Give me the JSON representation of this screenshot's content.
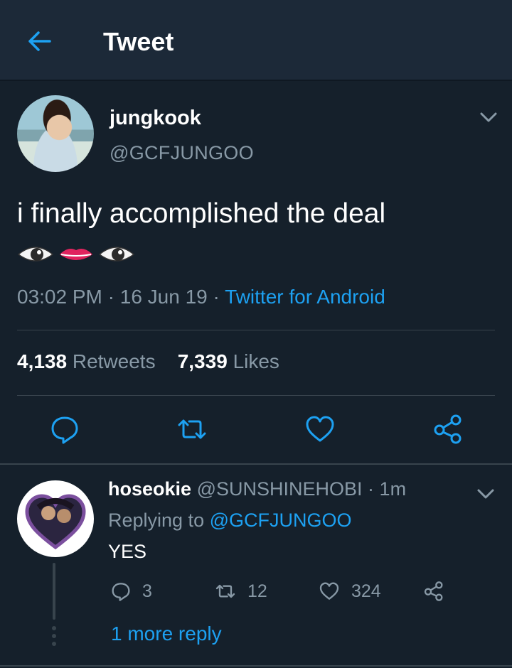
{
  "header": {
    "title": "Tweet",
    "back_icon": "back-arrow-icon"
  },
  "tweet": {
    "author_name": "jungkook",
    "author_handle": "@GCFJUNGOO",
    "text": "i finally accomplished the deal",
    "emojis": [
      "eye",
      "lips",
      "eye"
    ],
    "time": "03:02 PM",
    "date": "16 Jun 19",
    "source": "Twitter for Android",
    "retweets_count": "4,138",
    "retweets_label": "Retweets",
    "likes_count": "7,339",
    "likes_label": "Likes"
  },
  "reply": {
    "author_name": "hoseokie",
    "author_handle": "@SUNSHINEHOBI",
    "time": "1m",
    "replying_prefix": "Replying to",
    "replying_handle": "@GCFJUNGOO",
    "text": "YES",
    "reply_count": "3",
    "retweet_count": "12",
    "like_count": "324",
    "more_replies": "1 more reply"
  },
  "colors": {
    "background": "#15202b",
    "accent": "#1da1f2",
    "muted": "#8899a6",
    "divider": "#38444d"
  }
}
